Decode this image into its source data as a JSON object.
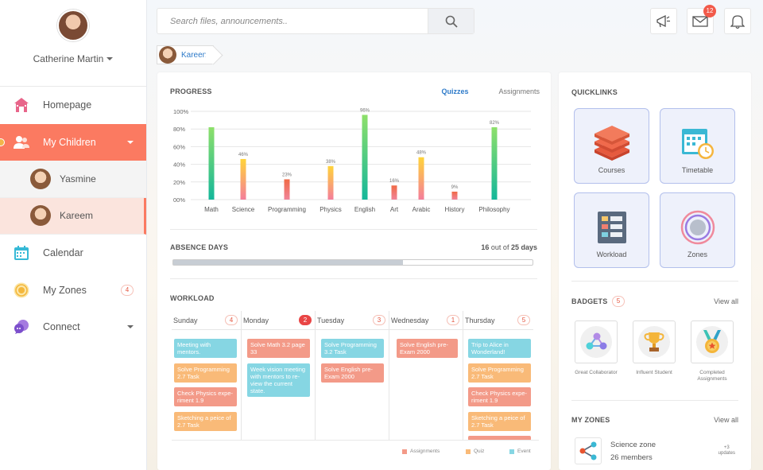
{
  "profile": {
    "name": "Catherine Martin"
  },
  "sidebar": {
    "items": [
      {
        "label": "Homepage",
        "icon": "house-icon"
      },
      {
        "label": "My Children",
        "icon": "users-icon"
      },
      {
        "label": "Calendar",
        "icon": "calendar-icon"
      },
      {
        "label": "My Zones",
        "icon": "zones-icon",
        "badge": "4"
      },
      {
        "label": "Connect",
        "icon": "chat-icon"
      }
    ],
    "children": [
      {
        "name": "Yasmine"
      },
      {
        "name": "Kareem"
      }
    ]
  },
  "search": {
    "placeholder": "Search files, announcements.."
  },
  "topbar": {
    "messages_count": "12"
  },
  "child_tag": {
    "name": "Kareem"
  },
  "progress": {
    "title": "PROGRESS",
    "tabs": [
      "Quizzes",
      "Assignments"
    ],
    "chart_data": {
      "type": "bar",
      "categories": [
        "Math",
        "Science",
        "Programming",
        "Physics",
        "English",
        "Art",
        "Arabic",
        "History",
        "Philosophy"
      ],
      "values": [
        null,
        46,
        23,
        38,
        96,
        16,
        48,
        9,
        82
      ],
      "value_labels": [
        "",
        "46%",
        "23%",
        "38%",
        "96%",
        "16%",
        "48%",
        "9%",
        "82%"
      ],
      "ylim": [
        0,
        100
      ],
      "yticks": [
        "00%",
        "20%",
        "40%",
        "60%",
        "80%",
        "100%"
      ],
      "colors": [
        "green",
        "yellow",
        "red",
        "yellow",
        "green",
        "red",
        "yellow",
        "red",
        "green"
      ]
    }
  },
  "absence": {
    "title": "ABSENCE DAYS",
    "used": "16",
    "out_of": "out of",
    "total": "25 days",
    "fraction": 0.64
  },
  "workload": {
    "title": "WORKLOAD",
    "days": [
      {
        "name": "Sunday",
        "count": "4",
        "highlight": false,
        "cards": [
          {
            "text": "Meeting with mentors.",
            "color": "blue"
          },
          {
            "text": "Solve Programming 2.7 Task",
            "color": "org"
          },
          {
            "text": "Check Physics expe-riment 1.9",
            "color": "red"
          },
          {
            "text": "Sketching a peice of 2.7 Task",
            "color": "org"
          }
        ]
      },
      {
        "name": "Monday",
        "count": "2",
        "highlight": true,
        "cards": [
          {
            "text": "Solve Math 3.2 page 33",
            "color": "red"
          },
          {
            "text": "Week vision meeting with mentors to re-view the current state.",
            "color": "blue"
          }
        ]
      },
      {
        "name": "Tuesday",
        "count": "3",
        "highlight": false,
        "cards": [
          {
            "text": "Solve Programming 3.2 Task",
            "color": "blue"
          },
          {
            "text": "Solve English pre-Exam 2000",
            "color": "red"
          }
        ]
      },
      {
        "name": "Wednesday",
        "count": "1",
        "highlight": false,
        "cards": [
          {
            "text": "Solve English pre-Exam 2000",
            "color": "red"
          }
        ]
      },
      {
        "name": "Thursday",
        "count": "5",
        "highlight": false,
        "cards": [
          {
            "text": "Trip to Alice in Wonderland!",
            "color": "blue"
          },
          {
            "text": "Solve Programming 2.7 Task",
            "color": "org"
          },
          {
            "text": "Check Physics expe-riment 1.9",
            "color": "red"
          },
          {
            "text": "Sketching a peice of 2.7 Task",
            "color": "org"
          }
        ]
      }
    ],
    "legend": [
      "Assignments",
      "Quiz",
      "Event"
    ]
  },
  "quicklinks": {
    "title": "QUICKLINKS",
    "items": [
      "Courses",
      "Timetable",
      "Workload",
      "Zones"
    ]
  },
  "badgets": {
    "title": "BADGETS",
    "count": "5",
    "view_all": "View all",
    "items": [
      "Great Collaborator",
      "Influent Student",
      "Completed Assignments"
    ]
  },
  "zones": {
    "title": "MY ZONES",
    "view_all": "View all",
    "item": {
      "name": "Science zone",
      "members": "26 members",
      "updates_count": "+3",
      "updates_label": "updates"
    }
  },
  "colors": {
    "accent": "#fb7a61",
    "link": "#2d7ac9",
    "green": "#1fc08f",
    "yellow": "#f7c734",
    "red": "#ee6a4d",
    "event": "#86d6e3",
    "quiz": "#f9ba78",
    "assignment": "#f39a88"
  }
}
